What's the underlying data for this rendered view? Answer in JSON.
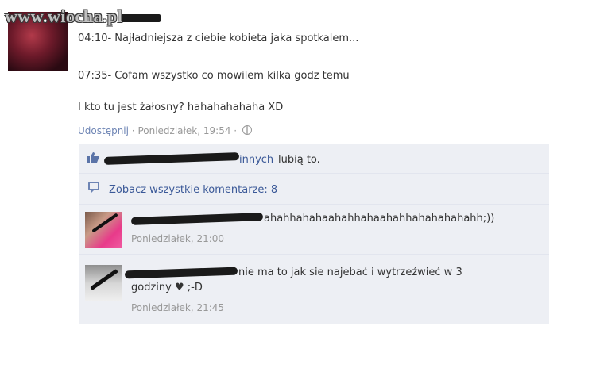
{
  "watermark": {
    "prefix": "www",
    "dot1": ".",
    "name": "wiocha",
    "dot2": ".",
    "tld": "pl"
  },
  "post": {
    "line1": "04:10- Najładniejsza z ciebie kobieta jaka spotkalem...",
    "line2": "07:35- Cofam wszystko co mowilem kilka godz temu",
    "line3": "I kto tu jest żałosny? hahahahahaha XD",
    "share_label": "Udostępnij",
    "separator": " · ",
    "timestamp": "Poniedziałek, 19:54",
    "separator2": " · "
  },
  "likes": {
    "others_link": "innych",
    "suffix": "lubią to."
  },
  "view_all": {
    "label": "Zobacz wszystkie komentarze: 8"
  },
  "comments": [
    {
      "text": "ahahhahahaahahhahaahahhahahahahahh;))",
      "time": "Poniedziałek, 21:00"
    },
    {
      "text_line1": "nie ma to jak sie najebać i wytrzeźwieć w 3",
      "text_line2": "godziny ♥ ;-D",
      "time": "Poniedziałek, 21:45"
    }
  ],
  "colors": {
    "link": "#3b5998",
    "ufi_bg": "#edeff4",
    "meta": "#999999"
  }
}
